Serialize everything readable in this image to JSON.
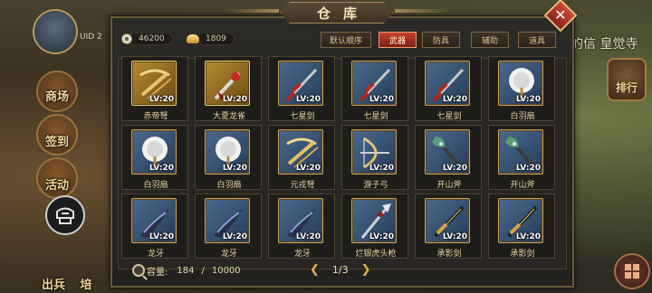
{
  "hud": {
    "uid": "UID 2",
    "left_buttons": [
      "商场",
      "签到",
      "活动"
    ],
    "bottom_left": [
      "出兵",
      "培"
    ],
    "right_text": "的信 皇觉寺",
    "right_badge": "排行"
  },
  "window": {
    "title": "仓库",
    "close": "✕"
  },
  "currency": {
    "copper": "46200",
    "ingot": "1809"
  },
  "tabs": [
    "默认顺序",
    "武器",
    "防具",
    "辅助",
    "道具"
  ],
  "active_tab": 1,
  "items": [
    {
      "name": "赤帝弩",
      "level": "LV:20",
      "frame": "gold",
      "icon": "crossbow-icon"
    },
    {
      "name": "大夏龙雀",
      "level": "LV:20",
      "frame": "gold",
      "icon": "dragon-blade-icon"
    },
    {
      "name": "七星剑",
      "level": "LV:20",
      "frame": "blue",
      "icon": "red-sword-icon"
    },
    {
      "name": "七星剑",
      "level": "LV:20",
      "frame": "blue",
      "icon": "red-sword-icon"
    },
    {
      "name": "七星剑",
      "level": "LV:20",
      "frame": "blue",
      "icon": "red-sword-icon"
    },
    {
      "name": "白羽扇",
      "level": "LV:20",
      "frame": "blue",
      "icon": "feather-fan-icon"
    },
    {
      "name": "白羽扇",
      "level": "LV:20",
      "frame": "blue",
      "icon": "feather-fan-icon"
    },
    {
      "name": "白羽扇",
      "level": "LV:20",
      "frame": "blue",
      "icon": "feather-fan-icon"
    },
    {
      "name": "元戎弩",
      "level": "LV:20",
      "frame": "blue",
      "icon": "crossbow-icon"
    },
    {
      "name": "游子弓",
      "level": "LV:20",
      "frame": "blue",
      "icon": "bow-icon"
    },
    {
      "name": "开山斧",
      "level": "LV:20",
      "frame": "blue",
      "icon": "axe-icon"
    },
    {
      "name": "开山斧",
      "level": "LV:20",
      "frame": "blue",
      "icon": "axe-icon"
    },
    {
      "name": "龙牙",
      "level": "LV:20",
      "frame": "blue",
      "icon": "dark-blade-icon"
    },
    {
      "name": "龙牙",
      "level": "LV:20",
      "frame": "blue",
      "icon": "dark-blade-icon"
    },
    {
      "name": "龙牙",
      "level": "LV:20",
      "frame": "blue",
      "icon": "dark-blade-icon"
    },
    {
      "name": "烂银虎头枪",
      "level": "LV:20",
      "frame": "blue",
      "icon": "spear-icon"
    },
    {
      "name": "承影剑",
      "level": "LV:20",
      "frame": "blue",
      "icon": "gold-sword-icon"
    },
    {
      "name": "承影剑",
      "level": "LV:20",
      "frame": "blue",
      "icon": "gold-sword-icon"
    }
  ],
  "footer": {
    "capacity_label": "容量:",
    "capacity_used": "184",
    "capacity_sep": "/",
    "capacity_max": "10000",
    "page": "1/3",
    "prev": "❮",
    "next": "❯"
  }
}
